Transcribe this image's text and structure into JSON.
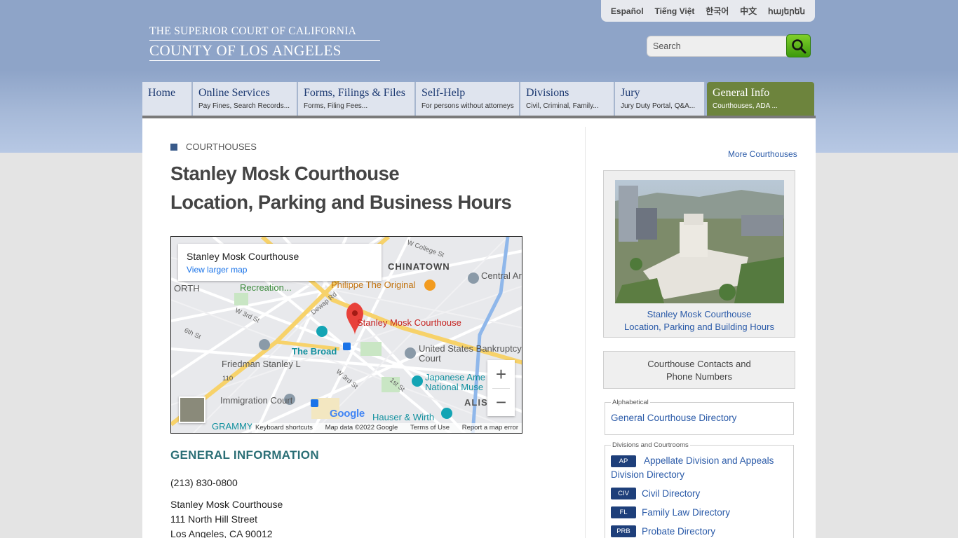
{
  "languages": [
    "Español",
    "Tiếng Việt",
    "한국어",
    "中文",
    "հայերեն"
  ],
  "logo": {
    "line1": "THE SUPERIOR COURT OF CALIFORNIA",
    "line2": "COUNTY OF LOS ANGELES"
  },
  "search": {
    "placeholder": "Search"
  },
  "nav": [
    {
      "title": "Home",
      "sub": ""
    },
    {
      "title": "Online Services",
      "sub": "Pay Fines, Search Records..."
    },
    {
      "title": "Forms, Filings & Files",
      "sub": "Forms, Filing Fees..."
    },
    {
      "title": "Self-Help",
      "sub": "For persons without attorneys"
    },
    {
      "title": "Divisions",
      "sub": "Civil, Criminal, Family..."
    },
    {
      "title": "Jury",
      "sub": "Jury Duty Portal, Q&A..."
    },
    {
      "title": "General Info",
      "sub": "Courthouses, ADA ..."
    }
  ],
  "page": {
    "category": "COURTHOUSES",
    "title_line1": "Stanley Mosk Courthouse",
    "title_line2": "Location, Parking and Business Hours"
  },
  "map": {
    "card_name": "Stanley Mosk Courthouse",
    "card_link": "View larger map",
    "marker_label": "Stanley Mosk Courthouse",
    "labels": [
      "CHINATOWN",
      "Recreation...",
      "Philippe The Original",
      "Central Arraignm",
      "The Broad",
      "United States Bankruptcy Court",
      "Friedman Stanley L",
      "Japanese Ame National Muse",
      "Immigration Court",
      "Hauser & Wirth",
      "GRAMMY",
      "W College St",
      "Dewap Rd",
      "W 3rd St",
      "6th St",
      "W 3rd St",
      "1st St",
      "ALIS",
      "110",
      "ORTH"
    ],
    "zoom_in": "+",
    "zoom_out": "−",
    "google": "Google",
    "footer": [
      "Keyboard shortcuts",
      "Map data ©2022 Google",
      "Terms of Use",
      "Report a map error"
    ]
  },
  "general": {
    "heading": "GENERAL INFORMATION",
    "phone": "(213) 830-0800",
    "address": [
      "Stanley Mosk Courthouse",
      "111 North Hill Street",
      "Los Angeles, CA 90012"
    ]
  },
  "sidebar": {
    "more": "More Courthouses",
    "photo_caption_1": "Stanley Mosk Courthouse",
    "photo_caption_2": "Location, Parking and Building Hours",
    "contacts_1": "Courthouse Contacts and",
    "contacts_2": "Phone Numbers",
    "alpha_legend": "Alphabetical",
    "alpha_link": "General Courthouse Directory",
    "div_legend": "Divisions and Courtrooms",
    "directories": [
      {
        "badge": "AP",
        "label": "Appellate Division and Appeals Division Directory"
      },
      {
        "badge": "CIV",
        "label": "Civil Directory"
      },
      {
        "badge": "FL",
        "label": "Family Law Directory"
      },
      {
        "badge": "PRB",
        "label": "Probate Directory"
      }
    ]
  },
  "colors": {
    "header_blue": "#8ea4c8",
    "nav_active": "#6d843d",
    "link": "#2a5aa8",
    "heading_teal": "#2b6f76",
    "badge": "#1e3f7a"
  }
}
